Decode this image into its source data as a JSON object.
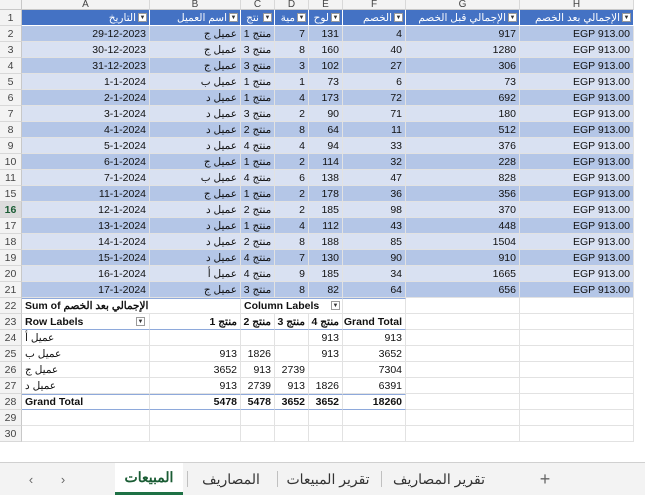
{
  "columns": [
    "A",
    "B",
    "C",
    "D",
    "E",
    "F",
    "G",
    "H"
  ],
  "table_headers": [
    "التاريخ",
    "اسم العميل",
    "نتج",
    "مية",
    "لوح",
    "الخصم",
    "الإجمالي قبل الخصم",
    "الإجمالي بعد الخصم"
  ],
  "sales_rows": [
    {
      "row": "2",
      "date": "29-12-2023",
      "customer": "عميل ج",
      "product": "منتج 1",
      "qty": "7",
      "price": "131",
      "discount": "4",
      "before": "917",
      "after": "EGP 913.00"
    },
    {
      "row": "3",
      "date": "30-12-2023",
      "customer": "عميل ج",
      "product": "منتج 3",
      "qty": "8",
      "price": "160",
      "discount": "40",
      "before": "1280",
      "after": "EGP 913.00"
    },
    {
      "row": "4",
      "date": "31-12-2023",
      "customer": "عميل ج",
      "product": "منتج 3",
      "qty": "3",
      "price": "102",
      "discount": "27",
      "before": "306",
      "after": "EGP 913.00"
    },
    {
      "row": "5",
      "date": "1-1-2024",
      "customer": "عميل ب",
      "product": "منتج 1",
      "qty": "1",
      "price": "73",
      "discount": "6",
      "before": "73",
      "after": "EGP 913.00"
    },
    {
      "row": "6",
      "date": "2-1-2024",
      "customer": "عميل د",
      "product": "منتج 1",
      "qty": "4",
      "price": "173",
      "discount": "72",
      "before": "692",
      "after": "EGP 913.00"
    },
    {
      "row": "7",
      "date": "3-1-2024",
      "customer": "عميل د",
      "product": "منتج 3",
      "qty": "2",
      "price": "90",
      "discount": "71",
      "before": "180",
      "after": "EGP 913.00"
    },
    {
      "row": "8",
      "date": "4-1-2024",
      "customer": "عميل د",
      "product": "منتج 2",
      "qty": "8",
      "price": "64",
      "discount": "11",
      "before": "512",
      "after": "EGP 913.00"
    },
    {
      "row": "9",
      "date": "5-1-2024",
      "customer": "عميل د",
      "product": "منتج 4",
      "qty": "4",
      "price": "94",
      "discount": "33",
      "before": "376",
      "after": "EGP 913.00"
    },
    {
      "row": "10",
      "date": "6-1-2024",
      "customer": "عميل ج",
      "product": "منتج 1",
      "qty": "2",
      "price": "114",
      "discount": "32",
      "before": "228",
      "after": "EGP 913.00"
    },
    {
      "row": "11",
      "date": "7-1-2024",
      "customer": "عميل ب",
      "product": "منتج 4",
      "qty": "6",
      "price": "138",
      "discount": "47",
      "before": "828",
      "after": "EGP 913.00"
    },
    {
      "row": "15",
      "date": "11-1-2024",
      "customer": "عميل ج",
      "product": "منتج 1",
      "qty": "2",
      "price": "178",
      "discount": "36",
      "before": "356",
      "after": "EGP 913.00"
    },
    {
      "row": "16",
      "date": "12-1-2024",
      "customer": "عميل د",
      "product": "منتج 2",
      "qty": "2",
      "price": "185",
      "discount": "98",
      "before": "370",
      "after": "EGP 913.00"
    },
    {
      "row": "17",
      "date": "13-1-2024",
      "customer": "عميل د",
      "product": "منتج 1",
      "qty": "4",
      "price": "112",
      "discount": "43",
      "before": "448",
      "after": "EGP 913.00"
    },
    {
      "row": "18",
      "date": "14-1-2024",
      "customer": "عميل د",
      "product": "منتج 2",
      "qty": "8",
      "price": "188",
      "discount": "85",
      "before": "1504",
      "after": "EGP 913.00"
    },
    {
      "row": "19",
      "date": "15-1-2024",
      "customer": "عميل د",
      "product": "منتج 4",
      "qty": "7",
      "price": "130",
      "discount": "90",
      "before": "910",
      "after": "EGP 913.00"
    },
    {
      "row": "20",
      "date": "16-1-2024",
      "customer": "عميل أ",
      "product": "منتج 4",
      "qty": "9",
      "price": "185",
      "discount": "34",
      "before": "1665",
      "after": "EGP 913.00"
    },
    {
      "row": "21",
      "date": "17-1-2024",
      "customer": "عميل ج",
      "product": "منتج 3",
      "qty": "8",
      "price": "82",
      "discount": "64",
      "before": "656",
      "after": "EGP 913.00"
    }
  ],
  "pivot": {
    "rows": [
      "22",
      "23",
      "24",
      "25",
      "26",
      "27",
      "28"
    ],
    "value_label": "Sum of الإجمالي بعد الخصم",
    "column_labels": "Column Labels",
    "row_labels": "Row Labels",
    "col_heads": [
      "منتج 1",
      "منتج 2",
      "منتج 3",
      "منتج 4",
      "Grand Total"
    ],
    "lines": [
      {
        "label": "عميل أ",
        "v1": "",
        "v2": "",
        "v3": "",
        "v4": "913",
        "total": "913"
      },
      {
        "label": "عميل ب",
        "v1": "913",
        "v2": "1826",
        "v3": "",
        "v4": "913",
        "total": "3652"
      },
      {
        "label": "عميل ج",
        "v1": "3652",
        "v2": "913",
        "v3": "2739",
        "v4": "",
        "total": "7304"
      },
      {
        "label": "عميل د",
        "v1": "913",
        "v2": "2739",
        "v3": "913",
        "v4": "1826",
        "total": "6391"
      }
    ],
    "grand": {
      "label": "Grand Total",
      "v1": "5478",
      "v2": "5478",
      "v3": "3652",
      "v4": "3652",
      "total": "18260"
    }
  },
  "empty_rows": [
    "29",
    "30"
  ],
  "sheet_tabs": [
    {
      "label": "المبيعات",
      "active": true
    },
    {
      "label": "المصاريف",
      "active": false
    },
    {
      "label": "تقرير المبيعات",
      "active": false
    },
    {
      "label": "تقرير المصاريف",
      "active": false
    }
  ],
  "add_sheet": "+",
  "nav_prev": "‹",
  "nav_next": "›",
  "colors": {
    "header_blue": "#4472c4",
    "band_dark": "#b4c6e7",
    "band_light": "#d9e1f2",
    "active_green": "#1e7145"
  }
}
